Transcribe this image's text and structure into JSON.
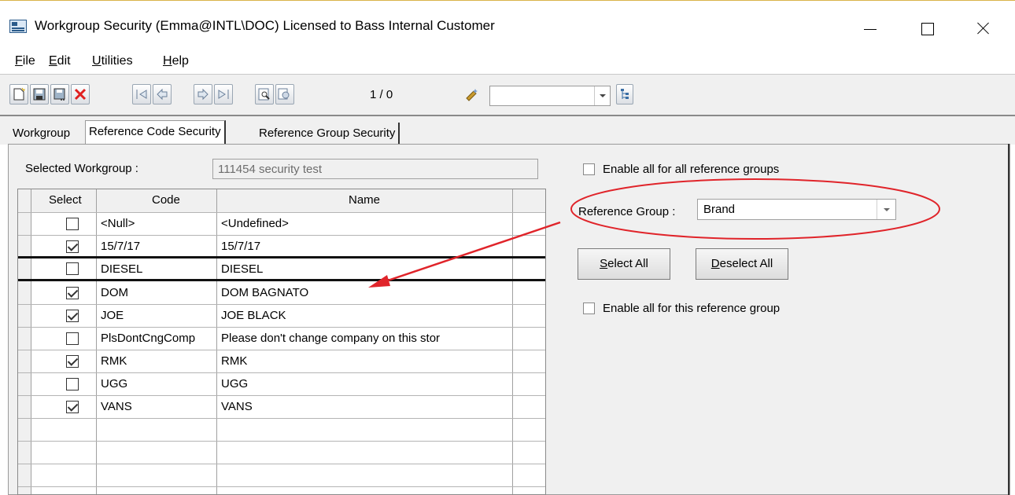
{
  "window": {
    "title": "Workgroup Security (Emma@INTL\\DOC) Licensed to Bass Internal Customer",
    "icon": "app-window-icon"
  },
  "menu": {
    "items": [
      {
        "accel": "F",
        "rest": "ile"
      },
      {
        "accel": "E",
        "rest": "dit"
      },
      {
        "accel": "U",
        "rest": "tilities"
      },
      {
        "accel": "H",
        "rest": "elp"
      }
    ]
  },
  "toolbar": {
    "icons": [
      "new-icon",
      "save-icon",
      "save-as-icon",
      "delete-icon",
      "first-record-icon",
      "previous-record-icon",
      "next-record-icon",
      "last-record-icon",
      "find-icon",
      "find-next-icon",
      "wizard-icon",
      "tree-icon"
    ],
    "counter": "1 / 0",
    "combo_value": "",
    "delete_color": "#e02020"
  },
  "tabs": [
    {
      "label": "Workgroup"
    },
    {
      "label": "Reference Code Security"
    },
    {
      "label": "Reference Group Security"
    }
  ],
  "workgroup": {
    "label": "Selected Workgroup :",
    "value": "111454 security test"
  },
  "grid": {
    "columns": [
      "Select",
      "Code",
      "Name"
    ],
    "rows": [
      {
        "checked": false,
        "code": "<Null>",
        "name": "<Undefined>"
      },
      {
        "checked": true,
        "code": "15/7/17",
        "name": "15/7/17"
      },
      {
        "checked": false,
        "code": "DIESEL",
        "name": "DIESEL"
      },
      {
        "checked": true,
        "code": "DOM",
        "name": "DOM BAGNATO"
      },
      {
        "checked": true,
        "code": "JOE",
        "name": "JOE BLACK"
      },
      {
        "checked": false,
        "code": "PlsDontCngComp",
        "name": "Please don't change company on this stor"
      },
      {
        "checked": true,
        "code": "RMK",
        "name": "RMK"
      },
      {
        "checked": false,
        "code": "UGG",
        "name": "UGG"
      },
      {
        "checked": true,
        "code": "VANS",
        "name": "VANS"
      }
    ]
  },
  "options": {
    "enable_all_groups": {
      "label": "Enable all for all reference groups",
      "checked": false
    },
    "reference_group_label": "Reference Group :",
    "reference_group_value": "Brand",
    "select_all": {
      "accel": "S",
      "rest": "elect All"
    },
    "deselect_all": {
      "accel": "D",
      "rest": "eselect All"
    },
    "enable_this_group": {
      "label": "Enable all for this reference group",
      "checked": false
    }
  },
  "annotation": {
    "color": "#e0242a"
  }
}
